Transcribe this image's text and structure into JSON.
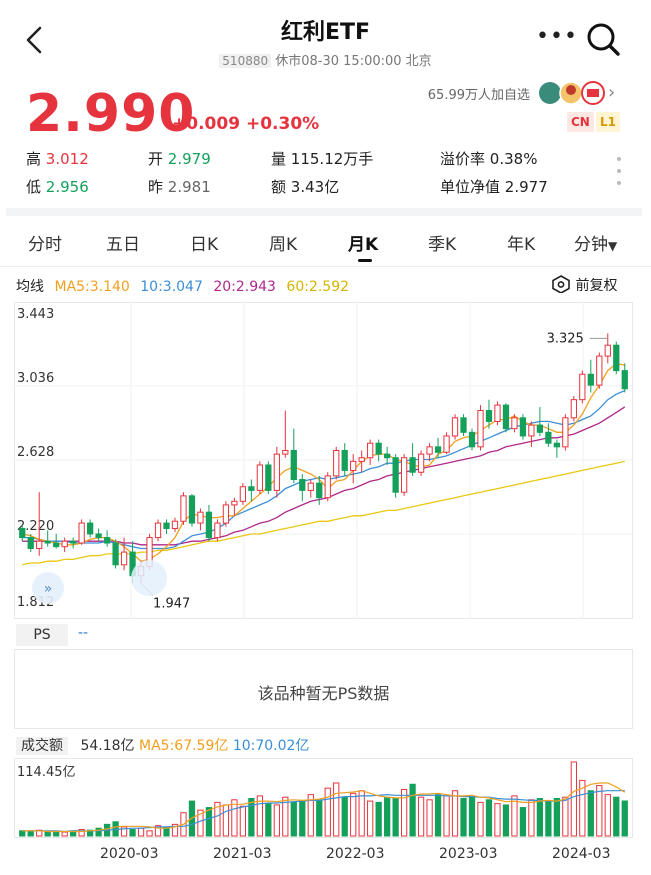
{
  "header": {
    "title": "红利ETF",
    "code": "510880",
    "status": "休市08-30 15:00:00 北京",
    "watch_count": "65.99万人加自选",
    "more_icon": "more-dots-icon",
    "search_icon": "search-icon"
  },
  "quote": {
    "price": "2.990",
    "change": "+0.009",
    "change_pct": "+0.30%",
    "badge_cn": "CN",
    "badge_l1": "L1",
    "high_label": "高",
    "high": "3.012",
    "open_label": "开",
    "open": "2.979",
    "volume_label": "量",
    "volume": "115.12万手",
    "premium_label": "溢价率",
    "premium": "0.38%",
    "low_label": "低",
    "low": "2.956",
    "prev_label": "昨",
    "prev": "2.981",
    "amount_label": "额",
    "amount": "3.43亿",
    "nav_label": "单位净值",
    "nav": "2.977"
  },
  "tabs": [
    {
      "label": "分时"
    },
    {
      "label": "五日"
    },
    {
      "label": "日K"
    },
    {
      "label": "周K"
    },
    {
      "label": "月K"
    },
    {
      "label": "季K"
    },
    {
      "label": "年K"
    },
    {
      "label": "分钟"
    }
  ],
  "active_tab": "月K",
  "ma_legend": {
    "title": "均线",
    "ma5": "MA5:3.140",
    "ma10": "10:3.047",
    "ma20": "20:2.943",
    "ma60": "60:2.592",
    "fuquan": "前复权"
  },
  "colors": {
    "up": "#e5343e",
    "down": "#14a05a",
    "ma5": "#f0a020",
    "ma10": "#3b8fd6",
    "ma20": "#b0288a",
    "ma60": "#e8c812"
  },
  "ps": {
    "label": "PS",
    "value": "--",
    "empty_text": "该品种暂无PS数据"
  },
  "volume_legend": {
    "label": "成交额",
    "value": "54.18亿",
    "ma5": "MA5:67.59亿",
    "ma10": "10:70.02亿",
    "max_label": "114.45亿"
  },
  "chart_data": {
    "type": "candlestick",
    "y_ticks": [
      "3.443",
      "3.036",
      "2.628",
      "2.220",
      "1.812"
    ],
    "ylim": [
      1.812,
      3.443
    ],
    "x_labels": [
      "2020-03",
      "2021-03",
      "2022-03",
      "2023-03",
      "2024-03"
    ],
    "annotations": {
      "high": "3.325",
      "low": "1.947"
    },
    "candles": [
      [
        2.25,
        2.27,
        2.18,
        2.2
      ],
      [
        2.2,
        2.22,
        2.12,
        2.14
      ],
      [
        2.14,
        2.45,
        2.1,
        2.18
      ],
      [
        2.18,
        2.24,
        2.15,
        2.17
      ],
      [
        2.17,
        2.22,
        2.14,
        2.15
      ],
      [
        2.15,
        2.2,
        2.12,
        2.18
      ],
      [
        2.18,
        2.2,
        2.14,
        2.17
      ],
      [
        2.17,
        2.3,
        2.16,
        2.28
      ],
      [
        2.28,
        2.3,
        2.2,
        2.22
      ],
      [
        2.22,
        2.25,
        2.18,
        2.2
      ],
      [
        2.2,
        2.24,
        2.15,
        2.17
      ],
      [
        2.17,
        2.19,
        2.03,
        2.05
      ],
      [
        2.05,
        2.2,
        2.02,
        2.12
      ],
      [
        2.12,
        2.18,
        1.95,
        1.99
      ],
      [
        1.99,
        2.07,
        1.947,
        2.04
      ],
      [
        2.04,
        2.22,
        2.02,
        2.2
      ],
      [
        2.2,
        2.3,
        2.18,
        2.28
      ],
      [
        2.28,
        2.3,
        2.22,
        2.25
      ],
      [
        2.25,
        2.31,
        2.23,
        2.29
      ],
      [
        2.29,
        2.45,
        2.27,
        2.43
      ],
      [
        2.43,
        2.44,
        2.26,
        2.28
      ],
      [
        2.28,
        2.36,
        2.24,
        2.34
      ],
      [
        2.34,
        2.38,
        2.18,
        2.2
      ],
      [
        2.2,
        2.3,
        2.18,
        2.28
      ],
      [
        2.28,
        2.4,
        2.26,
        2.38
      ],
      [
        2.38,
        2.42,
        2.32,
        2.4
      ],
      [
        2.4,
        2.5,
        2.38,
        2.48
      ],
      [
        2.48,
        2.52,
        2.4,
        2.46
      ],
      [
        2.46,
        2.62,
        2.44,
        2.6
      ],
      [
        2.6,
        2.62,
        2.44,
        2.46
      ],
      [
        2.46,
        2.7,
        2.42,
        2.66
      ],
      [
        2.66,
        2.9,
        2.64,
        2.68
      ],
      [
        2.68,
        2.8,
        2.5,
        2.52
      ],
      [
        2.52,
        2.55,
        2.4,
        2.46
      ],
      [
        2.46,
        2.52,
        2.42,
        2.5
      ],
      [
        2.5,
        2.54,
        2.38,
        2.42
      ],
      [
        2.42,
        2.56,
        2.4,
        2.54
      ],
      [
        2.54,
        2.7,
        2.52,
        2.68
      ],
      [
        2.68,
        2.72,
        2.54,
        2.57
      ],
      [
        2.57,
        2.66,
        2.5,
        2.62
      ],
      [
        2.62,
        2.68,
        2.56,
        2.64
      ],
      [
        2.64,
        2.74,
        2.6,
        2.72
      ],
      [
        2.72,
        2.74,
        2.62,
        2.66
      ],
      [
        2.66,
        2.7,
        2.6,
        2.64
      ],
      [
        2.64,
        2.66,
        2.42,
        2.45
      ],
      [
        2.45,
        2.66,
        2.43,
        2.64
      ],
      [
        2.64,
        2.72,
        2.54,
        2.56
      ],
      [
        2.56,
        2.68,
        2.54,
        2.66
      ],
      [
        2.66,
        2.72,
        2.62,
        2.7
      ],
      [
        2.7,
        2.75,
        2.64,
        2.67
      ],
      [
        2.67,
        2.78,
        2.66,
        2.76
      ],
      [
        2.76,
        2.88,
        2.74,
        2.86
      ],
      [
        2.86,
        2.88,
        2.76,
        2.78
      ],
      [
        2.78,
        2.8,
        2.68,
        2.7
      ],
      [
        2.7,
        2.93,
        2.68,
        2.9
      ],
      [
        2.9,
        2.96,
        2.8,
        2.84
      ],
      [
        2.84,
        2.95,
        2.82,
        2.93
      ],
      [
        2.93,
        2.94,
        2.78,
        2.8
      ],
      [
        2.8,
        2.88,
        2.78,
        2.86
      ],
      [
        2.86,
        2.88,
        2.74,
        2.76
      ],
      [
        2.76,
        2.84,
        2.7,
        2.82
      ],
      [
        2.82,
        2.92,
        2.76,
        2.78
      ],
      [
        2.78,
        2.83,
        2.7,
        2.72
      ],
      [
        2.72,
        2.74,
        2.64,
        2.7
      ],
      [
        2.7,
        2.88,
        2.68,
        2.86
      ],
      [
        2.86,
        2.98,
        2.84,
        2.96
      ],
      [
        2.96,
        3.12,
        2.94,
        3.1
      ],
      [
        3.1,
        3.18,
        3.0,
        3.04
      ],
      [
        3.04,
        3.22,
        3.02,
        3.2
      ],
      [
        3.2,
        3.325,
        3.16,
        3.26
      ],
      [
        3.26,
        3.28,
        3.1,
        3.12
      ],
      [
        3.12,
        3.16,
        3.0,
        3.02
      ]
    ],
    "ma5": [
      2.22,
      2.21,
      2.19,
      2.18,
      2.17,
      2.16,
      2.16,
      2.17,
      2.19,
      2.2,
      2.2,
      2.18,
      2.15,
      2.11,
      2.07,
      2.08,
      2.11,
      2.15,
      2.2,
      2.29,
      2.33,
      2.32,
      2.31,
      2.31,
      2.32,
      2.32,
      2.36,
      2.4,
      2.44,
      2.48,
      2.53,
      2.57,
      2.59,
      2.57,
      2.55,
      2.52,
      2.47,
      2.51,
      2.52,
      2.57,
      2.62,
      2.65,
      2.66,
      2.66,
      2.63,
      2.62,
      2.6,
      2.59,
      2.6,
      2.66,
      2.68,
      2.73,
      2.75,
      2.76,
      2.79,
      2.82,
      2.85,
      2.85,
      2.87,
      2.84,
      2.82,
      2.82,
      2.8,
      2.78,
      2.78,
      2.82,
      2.88,
      2.97,
      3.04,
      3.12,
      3.16,
      3.15
    ],
    "ma10": [
      2.2,
      2.2,
      2.19,
      2.18,
      2.18,
      2.18,
      2.17,
      2.17,
      2.17,
      2.17,
      2.18,
      2.17,
      2.16,
      2.15,
      2.14,
      2.14,
      2.14,
      2.14,
      2.15,
      2.18,
      2.21,
      2.22,
      2.23,
      2.25,
      2.28,
      2.32,
      2.34,
      2.36,
      2.38,
      2.4,
      2.43,
      2.47,
      2.49,
      2.51,
      2.52,
      2.53,
      2.52,
      2.53,
      2.54,
      2.55,
      2.56,
      2.58,
      2.59,
      2.61,
      2.61,
      2.62,
      2.63,
      2.63,
      2.63,
      2.64,
      2.65,
      2.67,
      2.69,
      2.71,
      2.73,
      2.75,
      2.77,
      2.79,
      2.81,
      2.82,
      2.83,
      2.84,
      2.84,
      2.83,
      2.82,
      2.83,
      2.85,
      2.87,
      2.91,
      2.96,
      2.99,
      3.01
    ],
    "ma20": [
      2.18,
      2.18,
      2.18,
      2.18,
      2.18,
      2.18,
      2.18,
      2.18,
      2.18,
      2.18,
      2.18,
      2.18,
      2.17,
      2.17,
      2.16,
      2.16,
      2.16,
      2.16,
      2.16,
      2.17,
      2.18,
      2.18,
      2.19,
      2.2,
      2.21,
      2.23,
      2.24,
      2.26,
      2.28,
      2.29,
      2.31,
      2.34,
      2.36,
      2.38,
      2.4,
      2.41,
      2.42,
      2.44,
      2.46,
      2.47,
      2.49,
      2.51,
      2.52,
      2.54,
      2.55,
      2.56,
      2.57,
      2.58,
      2.59,
      2.6,
      2.61,
      2.62,
      2.63,
      2.64,
      2.65,
      2.67,
      2.68,
      2.7,
      2.71,
      2.72,
      2.73,
      2.74,
      2.75,
      2.75,
      2.76,
      2.77,
      2.79,
      2.81,
      2.83,
      2.86,
      2.89,
      2.92
    ],
    "ma60": [
      2.05,
      2.06,
      2.06,
      2.07,
      2.07,
      2.08,
      2.08,
      2.09,
      2.1,
      2.1,
      2.11,
      2.11,
      2.11,
      2.11,
      2.12,
      2.12,
      2.13,
      2.13,
      2.14,
      2.15,
      2.16,
      2.17,
      2.18,
      2.18,
      2.19,
      2.2,
      2.21,
      2.22,
      2.22,
      2.23,
      2.24,
      2.25,
      2.26,
      2.27,
      2.28,
      2.29,
      2.29,
      2.3,
      2.31,
      2.32,
      2.32,
      2.33,
      2.34,
      2.35,
      2.35,
      2.36,
      2.37,
      2.38,
      2.39,
      2.4,
      2.41,
      2.42,
      2.43,
      2.44,
      2.45,
      2.46,
      2.47,
      2.48,
      2.49,
      2.5,
      2.51,
      2.52,
      2.53,
      2.54,
      2.55,
      2.56,
      2.57,
      2.58,
      2.59,
      2.6,
      2.61,
      2.62
    ],
    "volume": [
      8,
      7,
      9,
      6,
      7,
      6,
      8,
      10,
      9,
      12,
      18,
      22,
      14,
      10,
      12,
      8,
      16,
      14,
      18,
      36,
      54,
      40,
      44,
      52,
      48,
      56,
      46,
      58,
      62,
      50,
      48,
      60,
      52,
      55,
      64,
      56,
      74,
      82,
      60,
      66,
      70,
      54,
      52,
      60,
      58,
      72,
      80,
      60,
      56,
      64,
      62,
      70,
      58,
      60,
      52,
      56,
      50,
      48,
      62,
      44,
      56,
      58,
      54,
      58,
      60,
      114.45,
      86,
      70,
      78,
      64,
      60,
      54.18
    ],
    "vol_ma5": [
      8,
      8,
      8,
      7,
      7,
      7,
      7,
      7,
      8,
      9,
      11,
      14,
      15,
      15,
      15,
      14,
      12,
      12,
      14,
      18,
      28,
      34,
      40,
      45,
      48,
      49,
      49,
      52,
      54,
      54,
      53,
      55,
      56,
      55,
      56,
      57,
      60,
      66,
      67,
      68,
      70,
      66,
      62,
      60,
      59,
      59,
      63,
      65,
      65,
      66,
      64,
      62,
      62,
      63,
      60,
      59,
      56,
      53,
      54,
      52,
      52,
      54,
      55,
      54,
      57,
      69,
      74,
      80,
      82,
      82,
      76,
      67.59
    ],
    "vol_ma10": [
      8,
      8,
      8,
      8,
      8,
      7,
      8,
      8,
      8,
      8,
      9,
      10,
      11,
      12,
      12,
      13,
      14,
      14,
      15,
      15,
      18,
      23,
      27,
      31,
      38,
      42,
      45,
      47,
      50,
      51,
      51,
      52,
      53,
      54,
      55,
      55,
      57,
      59,
      61,
      61,
      62,
      62,
      63,
      64,
      63,
      63,
      63,
      63,
      63,
      63,
      62,
      62,
      61,
      61,
      60,
      60,
      58,
      57,
      57,
      56,
      55,
      55,
      54,
      54,
      55,
      61,
      64,
      67,
      69,
      70,
      70,
      70.02
    ]
  }
}
